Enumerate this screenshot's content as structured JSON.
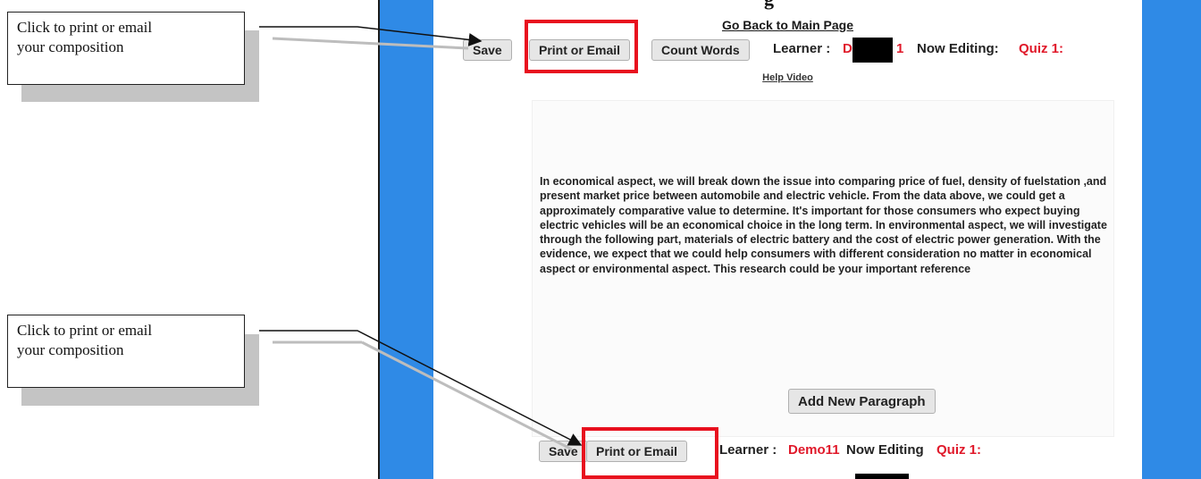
{
  "callouts": [
    {
      "text_line1": "Click to print or email",
      "text_line2": "your composition"
    },
    {
      "text_line1": "Click to print or email",
      "text_line2": "your composition"
    }
  ],
  "top_heading_fragment": "g",
  "go_back_link": "Go Back to Main Page",
  "top_toolbar": {
    "save": "Save",
    "print_email": "Print or Email",
    "count_words": "Count Words",
    "learner_label": "Learner :",
    "learner_value_prefix": "D",
    "learner_value_suffix": "1",
    "now_editing_label": "Now Editing:",
    "quiz": "Quiz 1:"
  },
  "help_video": "Help Video",
  "paragraph": "In economical aspect, we will break down the issue into comparing price of fuel, density of fuelstation ,and present market price between automobile and electric vehicle. From the data above, we could get a approximately comparative value to determine. It's important for those consumers who expect buying electric vehicles will be an economical choice in the long term. In environmental aspect, we will investigate through the following part, materials of electric battery and the cost of electric power generation. With the evidence, we expect that we could help consumers with different consideration no matter in economical aspect or environmental aspect. This research could be your important reference",
  "add_paragraph": "Add New Paragraph",
  "bottom_toolbar": {
    "save": "Save",
    "print_email": "Print or Email",
    "learner_label": "Learner :",
    "learner_value": "Demo11",
    "now_editing_label": "Now Editing",
    "quiz": "Quiz 1:"
  },
  "colors": {
    "frame_blue": "#2f8ae6",
    "highlight_red": "#e8101e",
    "accent_red": "#e0192a"
  }
}
